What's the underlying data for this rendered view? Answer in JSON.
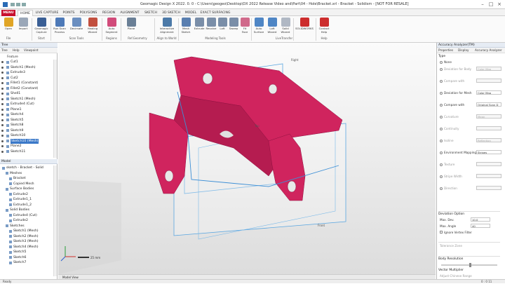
{
  "app": {
    "title": "Geomagic Design X 2022. 0. 0 - C:\\Users\\geogeo\\Desktop\\DX 2022 Release Video and\\Part\\04 - Hole\\Bracket.xrl - Bracket - Solidism - [NOT FOR RESALE]"
  },
  "tabs": [
    "MENU",
    "HOME",
    "LIVE CAPTURE",
    "POINTS",
    "POLYGONS",
    "REGION",
    "ALIGNMENT",
    "SKETCH",
    "3D SKETCH",
    "MODEL",
    "EXACT SURFACING"
  ],
  "ribbon": {
    "buttons": [
      {
        "label": "Open",
        "color": "#e0a526"
      },
      {
        "label": "Import",
        "color": "#9aa7b8"
      },
      {
        "label": "Geomagic Capture",
        "color": "#3a5f95"
      },
      {
        "label": "Run Scan Process",
        "color": "#4e7ab8"
      },
      {
        "label": "Decimate",
        "color": "#6b8fc0"
      },
      {
        "label": "Healing Wizard",
        "color": "#c2503f"
      },
      {
        "label": "Auto Segment",
        "color": "#d14b7a"
      },
      {
        "label": "Plane",
        "color": "#6a7f96"
      },
      {
        "label": "Interactive Alignment",
        "color": "#4c7aa8"
      },
      {
        "label": "Mesh Sketch",
        "color": "#5a7fb0"
      },
      {
        "label": "Extrude",
        "color": "#7a8ea8"
      },
      {
        "label": "Revolve",
        "color": "#7a8ea8"
      },
      {
        "label": "Loft",
        "color": "#7a8ea8"
      },
      {
        "label": "Sweep",
        "color": "#7a8ea8"
      },
      {
        "label": "Fit Face",
        "color": "#d06a8b"
      },
      {
        "label": "Auto Surface",
        "color": "#4f86c5"
      },
      {
        "label": "Loft Wizard",
        "color": "#4f86c5"
      },
      {
        "label": "Solid Wizard",
        "color": "#b0b8c4"
      },
      {
        "label": "SOLIDWORKS",
        "color": "#cc2d2d"
      },
      {
        "label": "Contact Help",
        "color": "#cc2d2d"
      }
    ],
    "groups": [
      "File",
      "Start",
      "Scan Tools",
      "Regions",
      "Ref.Geometry",
      "Align to World",
      "Modeling Tools",
      "LiveTransfer",
      "Help"
    ]
  },
  "left_panel": {
    "title": "Tree",
    "tabs": [
      "Tree",
      "Help",
      "Viewpoint"
    ],
    "feature_header": "Feature",
    "features": [
      {
        "label": "Cut1",
        "sel": false
      },
      {
        "label": "Sketch1 (Mesh)",
        "sel": false
      },
      {
        "label": "Extrude3",
        "sel": false
      },
      {
        "label": "Cut2",
        "sel": false
      },
      {
        "label": "Fillet1 (Constant)",
        "sel": false
      },
      {
        "label": "Fillet2 (Constant)",
        "sel": false
      },
      {
        "label": "Shell1",
        "sel": false
      },
      {
        "label": "Sketch1 (Mesh)",
        "sel": false
      },
      {
        "label": "Extrude4 (Cut)",
        "sel": false
      },
      {
        "label": "Plane1",
        "sel": false
      },
      {
        "label": "Sketch4",
        "sel": false
      },
      {
        "label": "Sketch5",
        "sel": false
      },
      {
        "label": "Sketch8",
        "sel": false
      },
      {
        "label": "Sketch9",
        "sel": false
      },
      {
        "label": "Sketch10",
        "sel": false
      },
      {
        "label": "Sketch10 (Mesh)",
        "sel": true
      },
      {
        "label": "Plane2",
        "sel": false
      },
      {
        "label": "Sketch11",
        "sel": false
      }
    ],
    "model_header": "Model",
    "model_tree": [
      {
        "label": "sketch - Bracket - Solid",
        "indent": 0
      },
      {
        "label": "Meshes",
        "indent": 1
      },
      {
        "label": "Bracket",
        "indent": 2
      },
      {
        "label": "Copied Mesh",
        "indent": 2
      },
      {
        "label": "Surface Bodies",
        "indent": 1
      },
      {
        "label": "Extrude2",
        "indent": 2
      },
      {
        "label": "Extrude1_1",
        "indent": 2
      },
      {
        "label": "Extrude1_2",
        "indent": 2
      },
      {
        "label": "Solid Bodies",
        "indent": 1
      },
      {
        "label": "Extrude4 (Cut)",
        "indent": 2
      },
      {
        "label": "Extrude2",
        "indent": 2
      },
      {
        "label": "Sketches",
        "indent": 1
      },
      {
        "label": "Sketch1 (Mesh)",
        "indent": 2
      },
      {
        "label": "Sketch2 (Mesh)",
        "indent": 2
      },
      {
        "label": "Sketch3 (Mesh)",
        "indent": 2
      },
      {
        "label": "Sketch4 (Mesh)",
        "indent": 2
      },
      {
        "label": "Sketch5",
        "indent": 2
      },
      {
        "label": "Sketch6",
        "indent": 2
      },
      {
        "label": "Sketch7",
        "indent": 2
      }
    ]
  },
  "viewport": {
    "labels": {
      "right": "Right",
      "top": "Top",
      "front": "Front"
    },
    "scale": "25 mm",
    "bottom_tab": "Model View",
    "mesh_color": "#d0245e",
    "plane_color": "#5aa6e0"
  },
  "right_panel": {
    "title": "Accuracy Analyzer(TM)",
    "tabs": [
      "Properties",
      "Display",
      "Accuracy Analyzer"
    ],
    "type_label": "Type",
    "options": [
      {
        "label": "None",
        "dim": false,
        "radio": true
      },
      {
        "label": "Deviation for Body",
        "dim": true,
        "field": "Color Map"
      },
      {
        "label": "Compare with",
        "dim": true,
        "field": ""
      },
      {
        "label": "Deviation for Mesh",
        "dim": false,
        "field": "Color Map"
      },
      {
        "label": "Compare with",
        "dim": false,
        "field": "Original Scan D"
      },
      {
        "label": "Curvature",
        "dim": true,
        "field": "Mean"
      },
      {
        "label": "Continuity",
        "dim": true,
        "field": ""
      },
      {
        "label": "Isoline",
        "dim": true,
        "field": "Reflection"
      },
      {
        "label": "Environment Mapping",
        "dim": false,
        "field": "Stripes"
      },
      {
        "label": "Texture",
        "dim": true,
        "field": ""
      },
      {
        "label": "Stripe Width",
        "dim": true,
        "field": ""
      },
      {
        "label": "Direction",
        "dim": true,
        "field": ""
      }
    ],
    "deviation_option": "Deviation Option",
    "max_dev_label": "Max. Dev.",
    "max_dev_value": "10.0",
    "max_angle_label": "Max. Angle",
    "max_angle_value": "40",
    "ignore_label": "Ignore Vertex Filter",
    "tolerance_label": "Tolerance Zone",
    "body_res_label": "Body Resolution",
    "vector_mult_label": "Vector Multiplier",
    "advanced_label": "Adjust Chinese Range"
  },
  "status": {
    "left": "Ready",
    "right": "0 : 0 11"
  }
}
